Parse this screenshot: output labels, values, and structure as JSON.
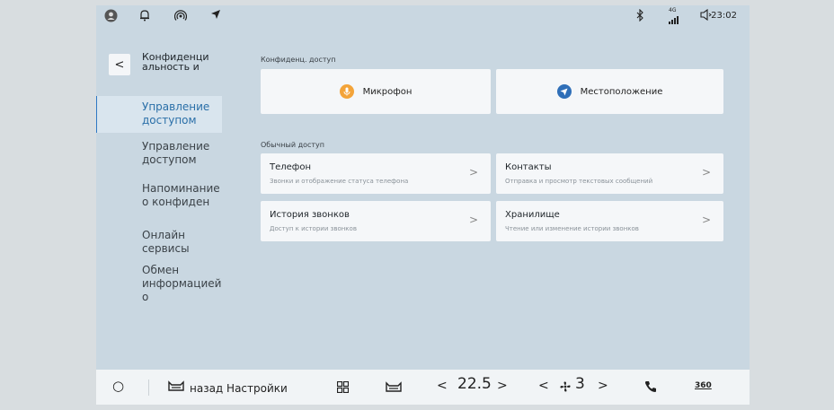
{
  "status_bar": {
    "icons": [
      "user-circle-icon",
      "bell-icon",
      "signal-icon",
      "location-arrow-icon"
    ],
    "right_icons": [
      "bluetooth-icon",
      "cellular-signal-icon",
      "volume-icon"
    ],
    "network_label": "4G",
    "time": "23:02"
  },
  "sidebar": {
    "back_label": "<",
    "title": "Конфиденци альность и",
    "items": [
      {
        "label": "Управление доступом",
        "active": true
      },
      {
        "label": "Управление доступом",
        "active": false
      },
      {
        "label": "Напоминание о конфиден",
        "active": false
      },
      {
        "label": "Онлайн сервисы",
        "active": false
      },
      {
        "label": "Обмен информацией о",
        "active": false
      }
    ]
  },
  "main": {
    "private_label": "Конфиденц. доступ",
    "private_cards": [
      {
        "label": "Микрофон",
        "icon": "microphone-icon",
        "color": "#f3a43a"
      },
      {
        "label": "Местоположение",
        "icon": "location-icon",
        "color": "#2f6fb8"
      }
    ],
    "normal_label": "Обычный доступ",
    "normal_cards": [
      {
        "title": "Телефон",
        "subtitle": "Звонки и отображение статуса телефона"
      },
      {
        "title": "Контакты",
        "subtitle": "Отправка и просмотр текстовых сообщений"
      },
      {
        "title": "История звонков",
        "subtitle": "Доступ к истории звонков"
      },
      {
        "title": "Хранилище",
        "subtitle": "Чтение или изменение истории звонков"
      }
    ],
    "chevron": ">"
  },
  "taskbar": {
    "home": "○",
    "back_label": "назад Настройки",
    "apps_icon": "apps-grid-icon",
    "car_icon": "car-seat-icon",
    "left_arrow": "<",
    "right_arrow": ">",
    "temperature": "22.5",
    "fan_level": "3",
    "phone_icon": "phone-icon",
    "view_label": "360"
  }
}
